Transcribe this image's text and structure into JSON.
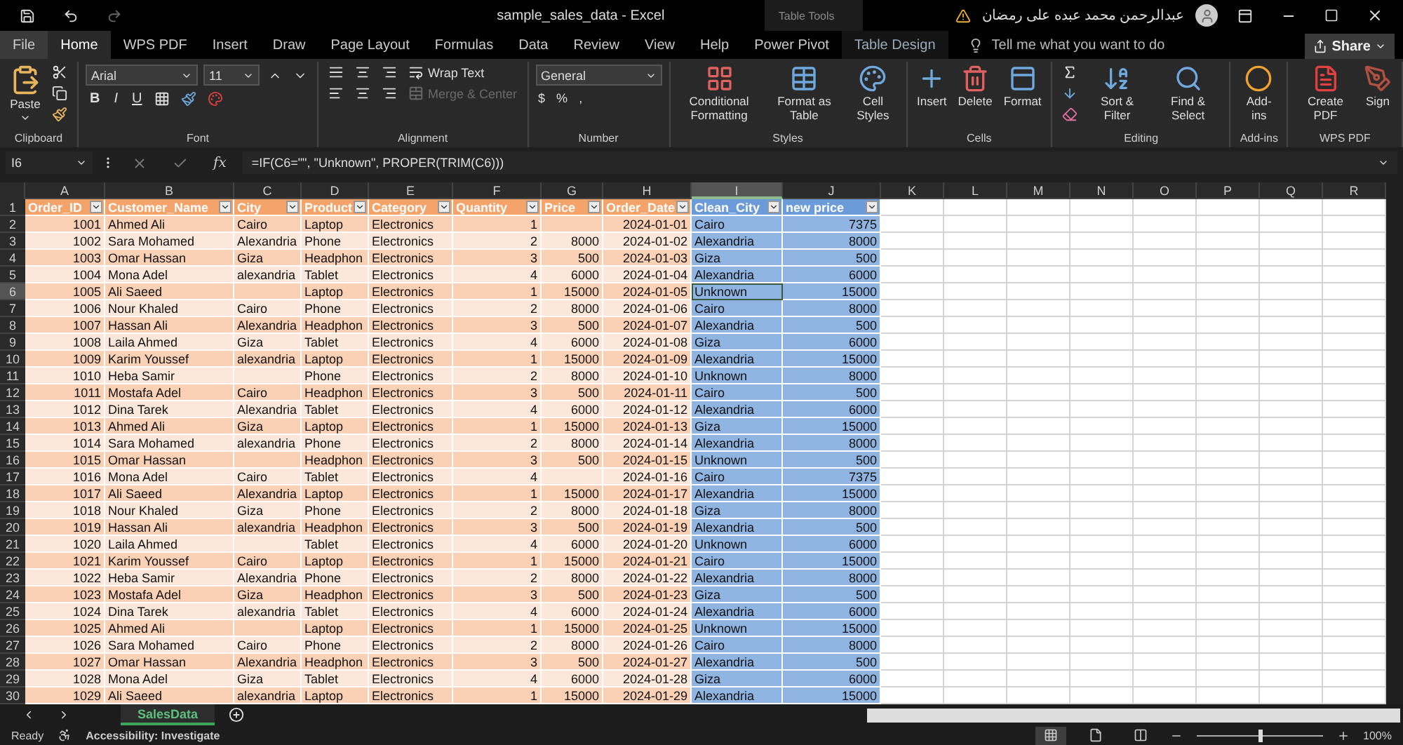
{
  "window": {
    "title": "sample_sales_data  -  Excel",
    "context_label": "Table Tools",
    "user": "عبدالرحمن محمد عبده على رمضان"
  },
  "tabs": [
    {
      "label": "File",
      "selected": false,
      "contextual": false
    },
    {
      "label": "Home",
      "selected": true,
      "contextual": false
    },
    {
      "label": "WPS PDF",
      "selected": false,
      "contextual": false
    },
    {
      "label": "Insert",
      "selected": false,
      "contextual": false
    },
    {
      "label": "Draw",
      "selected": false,
      "contextual": false
    },
    {
      "label": "Page Layout",
      "selected": false,
      "contextual": false
    },
    {
      "label": "Formulas",
      "selected": false,
      "contextual": false
    },
    {
      "label": "Data",
      "selected": false,
      "contextual": false
    },
    {
      "label": "Review",
      "selected": false,
      "contextual": false
    },
    {
      "label": "View",
      "selected": false,
      "contextual": false
    },
    {
      "label": "Help",
      "selected": false,
      "contextual": false
    },
    {
      "label": "Power Pivot",
      "selected": false,
      "contextual": false
    },
    {
      "label": "Table Design",
      "selected": false,
      "contextual": true
    }
  ],
  "tell_me": {
    "placeholder": "Tell me what you want to do"
  },
  "share": "Share",
  "ribbon": [
    {
      "kind": "clipboard",
      "label": "Clipboard",
      "paste": "Paste"
    },
    {
      "kind": "font",
      "label": "Font",
      "font": "Arial",
      "size": "11",
      "styles": [
        "B",
        "I",
        "U"
      ]
    },
    {
      "kind": "alignment",
      "label": "Alignment",
      "wrap": "Wrap Text",
      "merge": {
        "label": "Merge & Center",
        "disabled": true
      }
    },
    {
      "kind": "number",
      "label": "Number",
      "format": "General",
      "symbols": [
        "$",
        "%",
        ","
      ]
    },
    {
      "kind": "styles",
      "label": "Styles",
      "buttons": [
        "Conditional Formatting",
        "Format as Table",
        "Cell Styles"
      ]
    },
    {
      "kind": "cells",
      "label": "Cells",
      "buttons": [
        "Insert",
        "Delete",
        "Format"
      ]
    },
    {
      "kind": "editing",
      "label": "Editing",
      "buttons": [
        "Sort & Filter",
        "Find & Select"
      ]
    },
    {
      "kind": "addins",
      "label": "Add-ins",
      "buttons": [
        "Add-ins"
      ]
    },
    {
      "kind": "wps",
      "label": "WPS PDF",
      "buttons": [
        "Create PDF",
        "Sign"
      ]
    }
  ],
  "formula_bar": {
    "name_box": "I6",
    "fx": "fx",
    "formula": "=IF(C6=\"\", \"Unknown\", PROPER(TRIM(C6)))"
  },
  "table": {
    "header_row": "1",
    "columns": [
      {
        "letter": "A",
        "header": "Order_ID",
        "kind": "number",
        "color": "#f4a36b",
        "selected": false
      },
      {
        "letter": "B",
        "header": "Customer_Name",
        "kind": "text",
        "color": "#f4a36b",
        "selected": false
      },
      {
        "letter": "C",
        "header": "City",
        "kind": "text",
        "color": "#f4a36b",
        "selected": false
      },
      {
        "letter": "D",
        "header": "Product",
        "kind": "text",
        "color": "#f4a36b",
        "selected": false
      },
      {
        "letter": "E",
        "header": "Category",
        "kind": "text",
        "color": "#f4a36b",
        "selected": false
      },
      {
        "letter": "F",
        "header": "Quantity",
        "kind": "number",
        "color": "#f4a36b",
        "selected": false
      },
      {
        "letter": "G",
        "header": "Price",
        "kind": "number",
        "color": "#f4a36b",
        "selected": false
      },
      {
        "letter": "H",
        "header": "Order_Date",
        "kind": "number",
        "color": "#f4a36b",
        "selected": false
      },
      {
        "letter": "I",
        "header": "Clean_City",
        "kind": "text",
        "color": "#6b9bd8",
        "selected": true
      },
      {
        "letter": "J",
        "header": "new price",
        "kind": "number",
        "color": "#6b9bd8",
        "selected": false
      },
      {
        "letter": "K",
        "selected": false
      },
      {
        "letter": "L",
        "selected": false
      },
      {
        "letter": "M",
        "selected": false
      },
      {
        "letter": "N",
        "selected": false
      },
      {
        "letter": "O",
        "selected": false
      },
      {
        "letter": "P",
        "selected": false
      },
      {
        "letter": "Q",
        "selected": false
      },
      {
        "letter": "R",
        "selected": false
      }
    ],
    "rows": [
      {
        "n": "2",
        "selected": false,
        "cells": [
          "1001",
          "Ahmed Ali",
          "Cairo",
          "Laptop",
          "Electronics",
          "1",
          null,
          "2024-01-01",
          "Cairo",
          "7375"
        ]
      },
      {
        "n": "3",
        "selected": false,
        "cells": [
          "1002",
          "Sara Mohamed",
          "Alexandria",
          "Phone",
          "Electronics",
          "2",
          "8000",
          "2024-01-02",
          "Alexandria",
          "8000"
        ]
      },
      {
        "n": "4",
        "selected": false,
        "cells": [
          "1003",
          "Omar Hassan",
          "Giza",
          "Headphon",
          "Electronics",
          "3",
          "500",
          "2024-01-03",
          "Giza",
          "500"
        ]
      },
      {
        "n": "5",
        "selected": false,
        "cells": [
          "1004",
          "Mona Adel",
          "alexandria",
          "Tablet",
          "Electronics",
          "4",
          "6000",
          "2024-01-04",
          "Alexandria",
          "6000"
        ]
      },
      {
        "n": "6",
        "selected": true,
        "cells": [
          "1005",
          "Ali Saeed",
          null,
          "Laptop",
          "Electronics",
          "1",
          "15000",
          "2024-01-05",
          "Unknown",
          "15000"
        ]
      },
      {
        "n": "7",
        "selected": false,
        "cells": [
          "1006",
          "Nour Khaled",
          "Cairo",
          "Phone",
          "Electronics",
          "2",
          "8000",
          "2024-01-06",
          "Cairo",
          "8000"
        ]
      },
      {
        "n": "8",
        "selected": false,
        "cells": [
          "1007",
          "Hassan Ali",
          "Alexandria",
          "Headphon",
          "Electronics",
          "3",
          "500",
          "2024-01-07",
          "Alexandria",
          "500"
        ]
      },
      {
        "n": "9",
        "selected": false,
        "cells": [
          "1008",
          "Laila Ahmed",
          "Giza",
          "Tablet",
          "Electronics",
          "4",
          "6000",
          "2024-01-08",
          "Giza",
          "6000"
        ]
      },
      {
        "n": "10",
        "selected": false,
        "cells": [
          "1009",
          "Karim Youssef",
          "alexandria",
          "Laptop",
          "Electronics",
          "1",
          "15000",
          "2024-01-09",
          "Alexandria",
          "15000"
        ]
      },
      {
        "n": "11",
        "selected": false,
        "cells": [
          "1010",
          "Heba Samir",
          null,
          "Phone",
          "Electronics",
          "2",
          "8000",
          "2024-01-10",
          "Unknown",
          "8000"
        ]
      },
      {
        "n": "12",
        "selected": false,
        "cells": [
          "1011",
          "Mostafa Adel",
          "Cairo",
          "Headphon",
          "Electronics",
          "3",
          "500",
          "2024-01-11",
          "Cairo",
          "500"
        ]
      },
      {
        "n": "13",
        "selected": false,
        "cells": [
          "1012",
          "Dina Tarek",
          "Alexandria",
          "Tablet",
          "Electronics",
          "4",
          "6000",
          "2024-01-12",
          "Alexandria",
          "6000"
        ]
      },
      {
        "n": "14",
        "selected": false,
        "cells": [
          "1013",
          "Ahmed Ali",
          "Giza",
          "Laptop",
          "Electronics",
          "1",
          "15000",
          "2024-01-13",
          "Giza",
          "15000"
        ]
      },
      {
        "n": "15",
        "selected": false,
        "cells": [
          "1014",
          "Sara Mohamed",
          "alexandria",
          "Phone",
          "Electronics",
          "2",
          "8000",
          "2024-01-14",
          "Alexandria",
          "8000"
        ]
      },
      {
        "n": "16",
        "selected": false,
        "cells": [
          "1015",
          "Omar Hassan",
          null,
          "Headphon",
          "Electronics",
          "3",
          "500",
          "2024-01-15",
          "Unknown",
          "500"
        ]
      },
      {
        "n": "17",
        "selected": false,
        "cells": [
          "1016",
          "Mona Adel",
          "Cairo",
          "Tablet",
          "Electronics",
          "4",
          null,
          "2024-01-16",
          "Cairo",
          "7375"
        ]
      },
      {
        "n": "18",
        "selected": false,
        "cells": [
          "1017",
          "Ali Saeed",
          "Alexandria",
          "Laptop",
          "Electronics",
          "1",
          "15000",
          "2024-01-17",
          "Alexandria",
          "15000"
        ]
      },
      {
        "n": "19",
        "selected": false,
        "cells": [
          "1018",
          "Nour Khaled",
          "Giza",
          "Phone",
          "Electronics",
          "2",
          "8000",
          "2024-01-18",
          "Giza",
          "8000"
        ]
      },
      {
        "n": "20",
        "selected": false,
        "cells": [
          "1019",
          "Hassan Ali",
          "alexandria",
          "Headphon",
          "Electronics",
          "3",
          "500",
          "2024-01-19",
          "Alexandria",
          "500"
        ]
      },
      {
        "n": "21",
        "selected": false,
        "cells": [
          "1020",
          "Laila Ahmed",
          null,
          "Tablet",
          "Electronics",
          "4",
          "6000",
          "2024-01-20",
          "Unknown",
          "6000"
        ]
      },
      {
        "n": "22",
        "selected": false,
        "cells": [
          "1021",
          "Karim Youssef",
          "Cairo",
          "Laptop",
          "Electronics",
          "1",
          "15000",
          "2024-01-21",
          "Cairo",
          "15000"
        ]
      },
      {
        "n": "23",
        "selected": false,
        "cells": [
          "1022",
          "Heba Samir",
          "Alexandria",
          "Phone",
          "Electronics",
          "2",
          "8000",
          "2024-01-22",
          "Alexandria",
          "8000"
        ]
      },
      {
        "n": "24",
        "selected": false,
        "cells": [
          "1023",
          "Mostafa Adel",
          "Giza",
          "Headphon",
          "Electronics",
          "3",
          "500",
          "2024-01-23",
          "Giza",
          "500"
        ]
      },
      {
        "n": "25",
        "selected": false,
        "cells": [
          "1024",
          "Dina Tarek",
          "alexandria",
          "Tablet",
          "Electronics",
          "4",
          "6000",
          "2024-01-24",
          "Alexandria",
          "6000"
        ]
      },
      {
        "n": "26",
        "selected": false,
        "cells": [
          "1025",
          "Ahmed Ali",
          null,
          "Laptop",
          "Electronics",
          "1",
          "15000",
          "2024-01-25",
          "Unknown",
          "15000"
        ]
      },
      {
        "n": "27",
        "selected": false,
        "cells": [
          "1026",
          "Sara Mohamed",
          "Cairo",
          "Phone",
          "Electronics",
          "2",
          "8000",
          "2024-01-26",
          "Cairo",
          "8000"
        ]
      },
      {
        "n": "28",
        "selected": false,
        "cells": [
          "1027",
          "Omar Hassan",
          "Alexandria",
          "Headphon",
          "Electronics",
          "3",
          "500",
          "2024-01-27",
          "Alexandria",
          "500"
        ]
      },
      {
        "n": "29",
        "selected": false,
        "cells": [
          "1028",
          "Mona Adel",
          "Giza",
          "Tablet",
          "Electronics",
          "4",
          "6000",
          "2024-01-28",
          "Giza",
          "6000"
        ]
      },
      {
        "n": "30",
        "selected": false,
        "cells": [
          "1029",
          "Ali Saeed",
          "alexandria",
          "Laptop",
          "Electronics",
          "1",
          "15000",
          "2024-01-29",
          "Alexandria",
          "15000"
        ]
      }
    ]
  },
  "sheets": [
    {
      "label": "SalesData",
      "selected": true
    }
  ],
  "status_bar": {
    "status": "Ready",
    "accessibility": "Accessibility: Investigate",
    "views": [
      {
        "selected": true
      },
      {
        "selected": false
      },
      {
        "selected": false
      }
    ],
    "zoom": {
      "level": 0.5,
      "reading": "100%"
    }
  }
}
